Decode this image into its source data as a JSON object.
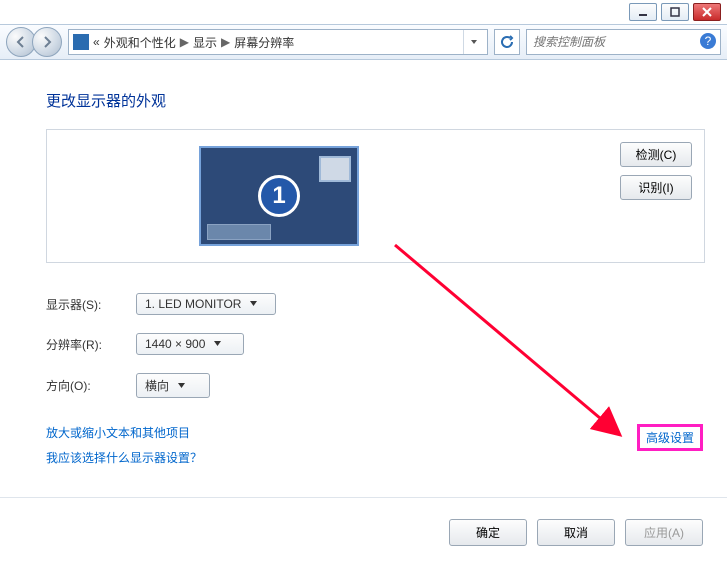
{
  "window": {
    "breadcrumbs": [
      "外观和个性化",
      "显示",
      "屏幕分辨率"
    ],
    "search_placeholder": "搜索控制面板"
  },
  "main": {
    "heading": "更改显示器的外观",
    "detect_label": "检测(C)",
    "identify_label": "识别(I)",
    "monitor_number": "1",
    "rows": {
      "display_label": "显示器(S):",
      "display_value": "1. LED MONITOR",
      "resolution_label": "分辨率(R):",
      "resolution_value": "1440 × 900",
      "orientation_label": "方向(O):",
      "orientation_value": "横向"
    },
    "advanced_link": "高级设置",
    "link1": "放大或缩小文本和其他项目",
    "link2": "我应该选择什么显示器设置？"
  },
  "footer": {
    "ok": "确定",
    "cancel": "取消",
    "apply": "应用(A)"
  }
}
